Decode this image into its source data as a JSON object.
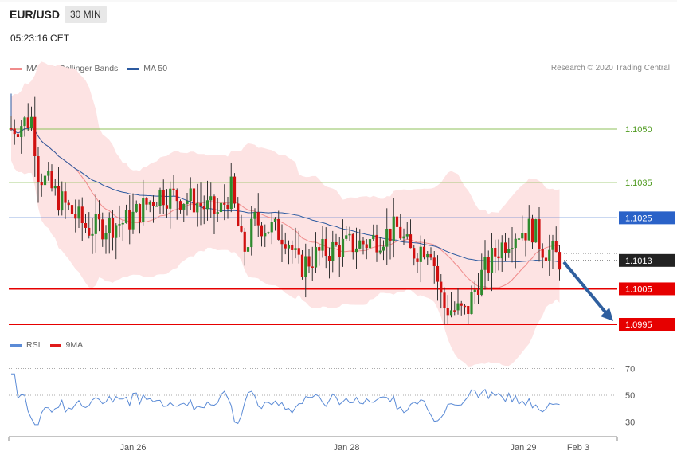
{
  "header": {
    "symbol": "EUR/USD",
    "timeframe": "30 MIN",
    "time": "05:23:16 CET"
  },
  "legend_top": {
    "bb_label": "MA 20 + Bollinger Bands",
    "ma50_label": "MA 50",
    "credit": "Research © 2020 Trading Central"
  },
  "legend_bottom": {
    "rsi_label": "RSI",
    "ma9_label": "9MA"
  },
  "colors": {
    "bb": "#f08c8c",
    "ma50": "#2c5aa0",
    "rsi": "#5b8bd6",
    "ma9": "#e01b1b",
    "up": "#2e8b2e",
    "down": "#d01010",
    "support": "#e60000",
    "resistance_green": "#8fc15b",
    "pivot": "#2a62c8",
    "arrow": "#2f5f9f"
  },
  "chart_data": {
    "type": "candlestick",
    "price_range": [
      1.099,
      1.107
    ],
    "levels": [
      {
        "value": 1.105,
        "label": "1.1050",
        "kind": "target-green"
      },
      {
        "value": 1.1035,
        "label": "1.1035",
        "kind": "target-green"
      },
      {
        "value": 1.1025,
        "label": "1.1025",
        "kind": "pivot"
      },
      {
        "value": 1.1013,
        "label": "1.1013",
        "kind": "last"
      },
      {
        "value": 1.1005,
        "label": "1.1005",
        "kind": "support"
      },
      {
        "value": 1.0995,
        "label": "1.0995",
        "kind": "support"
      }
    ],
    "x_ticks": [
      "Jan 26",
      "Jan 28",
      "Jan 29",
      "Feb 3"
    ],
    "rsi": {
      "range": [
        20,
        80
      ],
      "ticks": [
        70,
        50,
        30
      ]
    },
    "projection": {
      "from": 1.1013,
      "to": 1.0995
    }
  }
}
